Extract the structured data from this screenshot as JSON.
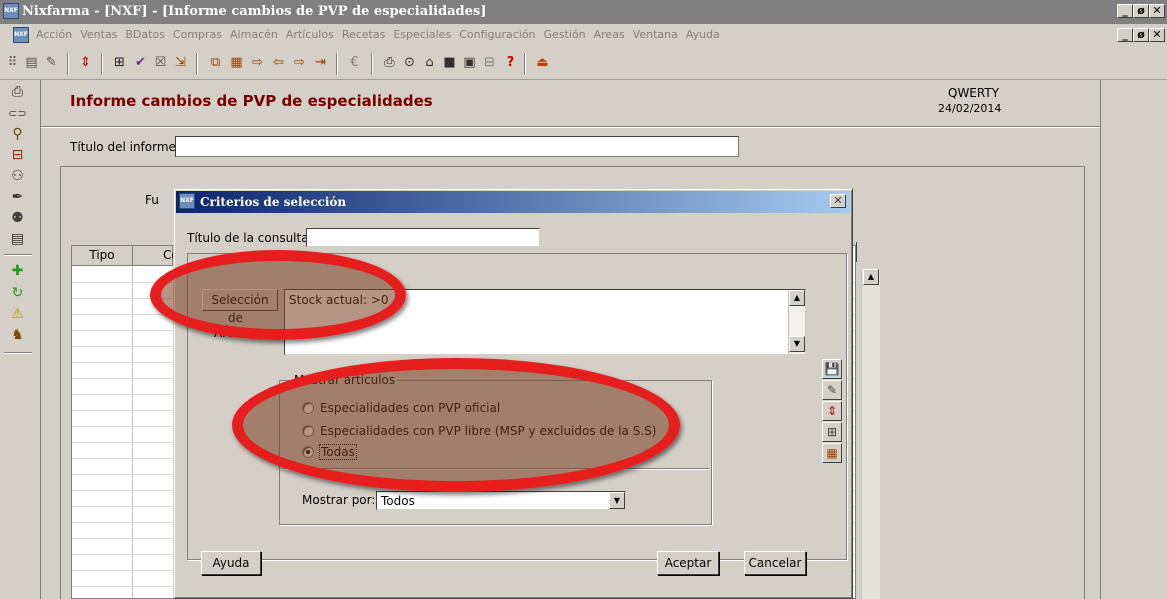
{
  "window": {
    "app_icon_text": "NXF",
    "title": "Nixfarma - [NXF] - [Informe cambios de PVP de especialidades]",
    "controls": [
      "_",
      "ø",
      "✕"
    ]
  },
  "menu": {
    "items": [
      "Acción",
      "Ventas",
      "BDatos",
      "Compras",
      "Almacén",
      "Artículos",
      "Recetas",
      "Especiales",
      "Configuración",
      "Gestión",
      "Areas",
      "Ventana",
      "Ayuda"
    ]
  },
  "toolbar_icons": [
    "list-icon",
    "edit-icon",
    "resize-icon",
    "binoculars-icon",
    "report-icon",
    "window-icon",
    "exit-icon",
    "copy-icon",
    "calc-icon",
    "next-icon",
    "back-icon",
    "forward-icon",
    "import-icon",
    "euro-icon",
    "printer-icon",
    "search-icon",
    "home-icon",
    "stop-icon",
    "view-icon",
    "cart-icon",
    "help-icon",
    "upload-icon"
  ],
  "left_icons": [
    "printer-icon",
    "link-icon",
    "user-search-icon",
    "cart-icon",
    "people-icon",
    "pen-icon",
    "users-icon",
    "monitor-icon",
    "add-icon",
    "refresh-icon",
    "warning-icon",
    "person-icon"
  ],
  "report": {
    "title": "Informe cambios de PVP de especialidades",
    "user": "QWERTY",
    "date": "24/02/2014",
    "title_label": "Título del informe",
    "title_value": "",
    "fu_label": "Fu",
    "grid_columns": [
      "Tipo",
      "Co"
    ]
  },
  "dialog": {
    "title": "Criterios de selección",
    "consulta_label": "Título de la consulta:",
    "consulta_value": "",
    "selection_button": "Selección",
    "selection_line2": "de",
    "selection_line3": "Artíc...",
    "criteria_text": "Stock actual: >0",
    "mostrar_articulos_label": "Mostrar artículos",
    "radios": [
      {
        "label": "Especialidades con PVP oficial",
        "selected": false
      },
      {
        "label": "Especialidades con PVP libre (MSP y excluidos de la S.S)",
        "selected": false
      },
      {
        "label": "Todas",
        "selected": true
      }
    ],
    "mostrar_por_label": "Mostrar por:",
    "mostrar_por_value": "Todos",
    "side_icons": [
      "save-icon",
      "edit-criteria-icon",
      "resize-icon",
      "search-list-icon",
      "export-icon"
    ],
    "buttons": {
      "help": "Ayuda",
      "accept": "Aceptar",
      "cancel": "Cancelar"
    }
  },
  "highlight_color": "#e61e1e"
}
